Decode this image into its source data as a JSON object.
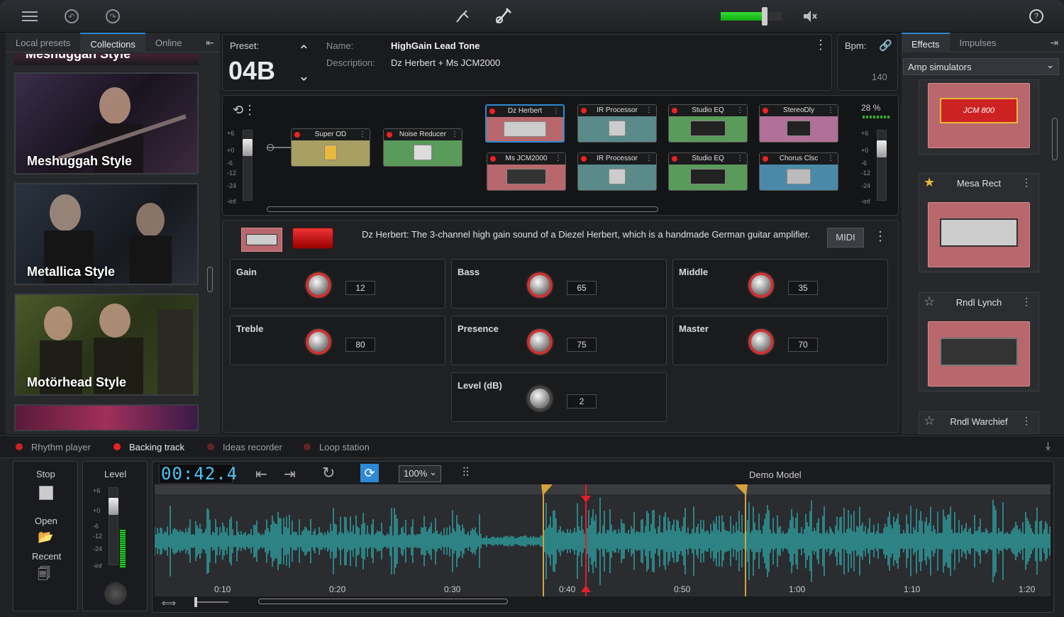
{
  "topbar": {
    "menu_icon": "hamburger-icon",
    "undo_icon": "undo-icon",
    "redo_icon": "redo-icon",
    "tuner_icon": "tuner-icon",
    "guitar_icon": "guitar-icon",
    "mute_icon": "mute-icon",
    "help_icon": "help-icon",
    "volume_level_percent": 70
  },
  "left": {
    "tabs": [
      "Local presets",
      "Collections",
      "Online"
    ],
    "active_tab": "Collections",
    "cards": [
      "Meshuggah Style",
      "Metallica Style",
      "Motörhead Style"
    ],
    "partial_top": "Meshuggah Style"
  },
  "preset": {
    "preset_label": "Preset:",
    "preset_value": "04B",
    "name_label": "Name:",
    "name_value": "HighGain Lead Tone",
    "description_label": "Description:",
    "description_value": "Dz Herbert + Ms JCM2000"
  },
  "bpm": {
    "label": "Bpm:",
    "value": "140"
  },
  "chain": {
    "input_meter_ticks": [
      "+6",
      "+0",
      "-6",
      "-12",
      "-24",
      "-inf"
    ],
    "output_meter_ticks": [
      "+6",
      "+0",
      "-6",
      "-12",
      "-24",
      "-inf"
    ],
    "output_percent": "28 %",
    "row0": [
      "Super OD",
      "Noise Reducer"
    ],
    "top_row": [
      "Dz Herbert",
      "IR Processor",
      "Studio EQ",
      "StereoDly"
    ],
    "bottom_row": [
      "Ms JCM2000",
      "IR Processor",
      "Studio EQ",
      "Chorus Clsc"
    ]
  },
  "amp": {
    "description": "Dz Herbert:  The 3-channel high gain sound of a Diezel Herbert, which is a handmade German guitar amplifier.",
    "midi_label": "MIDI",
    "knobs": [
      {
        "name": "Gain",
        "value": "12"
      },
      {
        "name": "Bass",
        "value": "65"
      },
      {
        "name": "Middle",
        "value": "35"
      },
      {
        "name": "Treble",
        "value": "80"
      },
      {
        "name": "Presence",
        "value": "75"
      },
      {
        "name": "Master",
        "value": "70"
      },
      {
        "name": "Level (dB)",
        "value": "2"
      }
    ]
  },
  "right": {
    "tabs": [
      "Effects",
      "Impulses"
    ],
    "active_tab": "Effects",
    "dropdown": "Amp simulators",
    "amps": [
      {
        "name": "",
        "badge": "JCM 800"
      },
      {
        "name": "Mesa Rect",
        "starred": true
      },
      {
        "name": "Rndl Lynch",
        "starred": false
      },
      {
        "name": "Rndl Warchief",
        "starred": false
      }
    ]
  },
  "bottom": {
    "tabs": [
      "Rhythm player",
      "Backing track",
      "Ideas recorder",
      "Loop station"
    ],
    "active_tab": "Backing track",
    "stop_label": "Stop",
    "open_label": "Open",
    "recent_label": "Recent",
    "level_label": "Level",
    "level_ticks": [
      "+6",
      "+0",
      "-6",
      "-12",
      "-24",
      "-inf"
    ],
    "time": "00:42.4",
    "zoom": "100%",
    "track_name": "Demo Model",
    "timeline": [
      "0:10",
      "0:20",
      "0:30",
      "0:40",
      "0:50",
      "1:00",
      "1:10",
      "1:20"
    ]
  },
  "colors": {
    "accent": "#2e89d6",
    "wave": "#2fa8a8",
    "marker_red": "#e0202a",
    "loop_gold": "#d6a23a"
  }
}
